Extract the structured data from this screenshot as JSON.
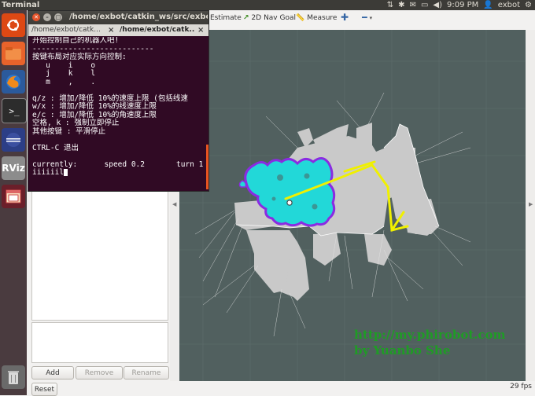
{
  "topbar": {
    "app_title": "Terminal",
    "clock": "9:09 PM",
    "user": "exbot"
  },
  "rviz": {
    "toolbar": {
      "estimate": "Estimate",
      "nav_goal": "2D Nav Goal",
      "measure": "Measure"
    },
    "buttons": {
      "add": "Add",
      "remove": "Remove",
      "rename": "Rename",
      "reset": "Reset"
    },
    "fps": "29 fps",
    "watermark": {
      "line1": "http://my.phirobot.com",
      "line2": "by Yuanbo She"
    }
  },
  "terminal": {
    "title": "/home/exbot/catkin_ws/src/exbot_x",
    "tabs": [
      "/home/exbot/catk...",
      "/home/exbot/catk..."
    ],
    "lines": [
      "开始控制自己的机器人吧!",
      "---------------------------",
      "按键布局对应实际方向控制:",
      "   u    i    o",
      "   j    k    l",
      "   m    ,    .",
      "",
      "q/z : 增加/降低 10%的速度上限 (包括线速",
      "w/x : 增加/降低 10%的线速度上限",
      "e/c : 增加/降低 10%的角速度上限",
      "空格, k : 强制立即停止",
      "其他按键 : 平滑停止",
      "",
      "CTRL-C 退出",
      "",
      "currently:      speed 0.2       turn 1"
    ],
    "input": "iiiiiil"
  },
  "colors": {
    "viewport_bg": "#51605f",
    "map_free": "#c8c8c8",
    "costmap_cyan": "#22d8d8",
    "costmap_purple": "#8a2be2",
    "path_yellow": "#f0f000",
    "terminal_bg": "#300a24",
    "launcher_bg": "#4a3b3f",
    "watermark_green": "#1f9c25"
  },
  "icons": {
    "launcher": [
      "ubuntu-dash-icon",
      "files-icon",
      "firefox-icon",
      "terminal-icon",
      "eclipse-icon",
      "rviz-icon",
      "workspace-switcher-icon",
      "trash-icon"
    ],
    "tray": [
      "network-icon",
      "bluetooth-icon",
      "mail-icon",
      "keyboard-icon",
      "volume-icon",
      "gear-icon"
    ]
  }
}
